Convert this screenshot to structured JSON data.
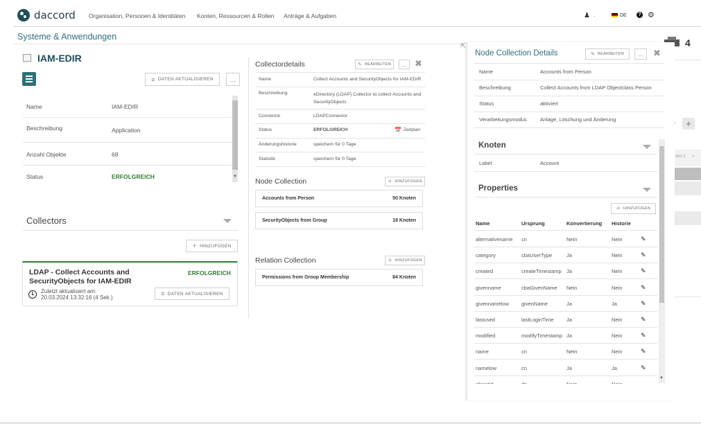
{
  "brand": {
    "name": "daccord"
  },
  "nav": {
    "items": [
      "Organisation, Personen & Identitäten",
      "Konten, Ressourcen & Rollen",
      "Anträge & Aufgaben"
    ],
    "user_label": ".",
    "lang": "DE",
    "help": "?",
    "settings_icon": "gear-icon"
  },
  "page": {
    "title": "Systeme & Anwendungen"
  },
  "system": {
    "name": "IAM-EDIR",
    "refresh_label": "DATEN AKTUALISIEREN",
    "more_label": "...",
    "details": [
      {
        "label": "Name",
        "value": "IAM-EDIR"
      },
      {
        "label": "Beschreibung",
        "value": "Application"
      },
      {
        "label": "Anzahl Objekte",
        "value": "68"
      },
      {
        "label": "Status",
        "value": "ERFOLGREICH"
      }
    ]
  },
  "collectors": {
    "title": "Collectors",
    "add_label": "HINZUFÜGEN",
    "card": {
      "title": "LDAP - Collect Accounts and SecurityObjects for IAM-EDIR",
      "status": "ERFOLGREICH",
      "updated_label": "Zuletzt aktualisiert am:",
      "updated_value": "20.03.2024 13:32:16 (4 Sek.)",
      "refresh_label": "DATEN AKTUALISIEREN"
    }
  },
  "collector_details": {
    "title": "Collectordetails",
    "edit_label": "BEARBEITEN",
    "more_label": "...",
    "rows": [
      {
        "label": "Name",
        "value": "Collect Accounts and SecurityObjects for IAM-EDIR"
      },
      {
        "label": "Beschreibung",
        "value": "eDirectory (LDAP) Collector to collect Accounts and SecurityObjects"
      },
      {
        "label": "Connector",
        "value": "LDAPConnector"
      },
      {
        "label": "Status",
        "value": "ERFOLGREICH"
      },
      {
        "label": "Änderungshistorie",
        "value": "speichern für 0 Tage"
      },
      {
        "label": "Statistik",
        "value": "speichern für 0 Tage"
      }
    ],
    "schedule_label": "Zeitplan"
  },
  "node_collection": {
    "title": "Node Collection",
    "add_label": "HINZUFÜGEN",
    "items": [
      {
        "name": "Accounts from Person",
        "count": "50 Knoten"
      },
      {
        "name": "SecurityObjects from Group",
        "count": "18 Knoten"
      }
    ]
  },
  "relation_collection": {
    "title": "Relation Collection",
    "add_label": "HINZUFÜGEN",
    "items": [
      {
        "name": "Permissions from Group Membership",
        "count": "84 Knoten"
      }
    ]
  },
  "ncd": {
    "title": "Node Collection Details",
    "edit_label": "BEARBEITEN",
    "more_label": "...",
    "rows": [
      {
        "label": "Name",
        "value": "Accounts from Person"
      },
      {
        "label": "Beschreibung",
        "value": "Collect Accounts from LDAP Objectclass Person"
      },
      {
        "label": "Status",
        "value": "aktiviert"
      },
      {
        "label": "Verarbeitungsmodus",
        "value": "Anlage, Löschung und Änderung"
      }
    ],
    "knoten_title": "Knoten",
    "knoten_row": {
      "label": "Label",
      "value": "Account"
    },
    "properties_title": "Properties",
    "add_label": "HINZUFÜGEN",
    "headers": [
      "Name",
      "Ursprung",
      "Konvertierung",
      "Historie"
    ],
    "props": [
      {
        "name": "alternativename",
        "origin": "cn",
        "conv": "Nein",
        "hist": "Nein"
      },
      {
        "name": "category",
        "origin": "cbaUserType",
        "conv": "Ja",
        "hist": "Nein"
      },
      {
        "name": "created",
        "origin": "createTimestamp",
        "conv": "Ja",
        "hist": "Nein"
      },
      {
        "name": "givenname",
        "origin": "cbaGivenName",
        "conv": "Nein",
        "hist": "Nein"
      },
      {
        "name": "givennamelow",
        "origin": "givenName",
        "conv": "Ja",
        "hist": "Ja"
      },
      {
        "name": "lastused",
        "origin": "lastLoginTime",
        "conv": "Ja",
        "hist": "Nein"
      },
      {
        "name": "modified",
        "origin": "modifyTimestamp",
        "conv": "Ja",
        "hist": "Nein"
      },
      {
        "name": "name",
        "origin": "cn",
        "conv": "Nein",
        "hist": "Nein"
      },
      {
        "name": "namelow",
        "origin": "cn",
        "conv": "Ja",
        "hist": "Ja"
      },
      {
        "name": "objectid",
        "origin": "dn",
        "conv": "Nein",
        "hist": "Nein"
      }
    ]
  },
  "bg": {
    "number": "4",
    "pager": "von 1"
  },
  "colors": {
    "accent": "#2f6f7a",
    "success": "#2e7d32",
    "brand_dark": "#1f4e5a"
  }
}
